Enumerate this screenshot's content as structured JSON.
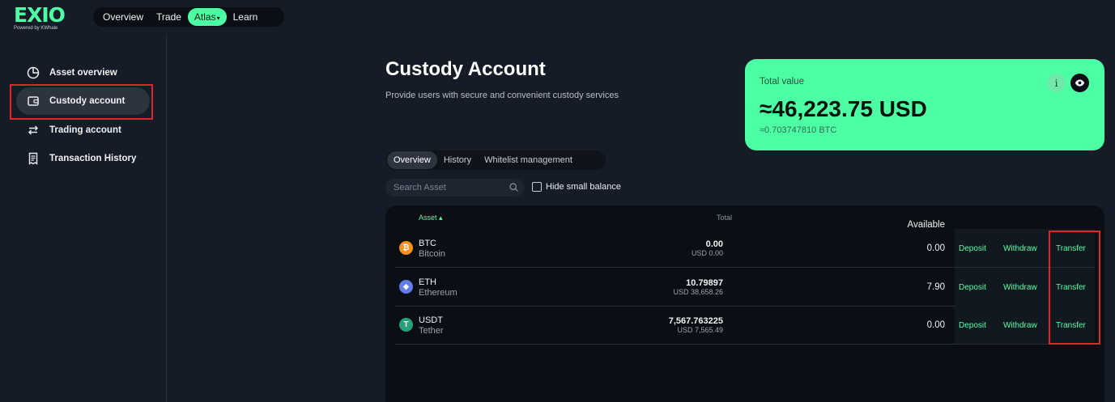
{
  "brand": {
    "logo": "EXIO",
    "tagline": "Powered by KWhale"
  },
  "topnav": [
    {
      "label": "Overview",
      "active": false
    },
    {
      "label": "Trade",
      "active": false
    },
    {
      "label": "Atlas",
      "active": true
    },
    {
      "label": "Learn",
      "active": false
    }
  ],
  "sidebar": {
    "items": [
      {
        "label": "Asset overview",
        "icon": "pie-chart-icon"
      },
      {
        "label": "Custody account",
        "icon": "wallet-icon",
        "active": true
      },
      {
        "label": "Trading account",
        "icon": "swap-arrows-icon"
      },
      {
        "label": "Transaction History",
        "icon": "receipt-icon"
      }
    ]
  },
  "page": {
    "title": "Custody Account",
    "subtitle": "Provide users with secure and convenient custody services"
  },
  "summary": {
    "label": "Total value",
    "value": "≈46,223.75 USD",
    "btc": "≈0.703747810 BTC",
    "info_label": "i"
  },
  "tabs": [
    {
      "label": "Overview",
      "active": true
    },
    {
      "label": "History",
      "active": false
    },
    {
      "label": "Whitelist management",
      "active": false
    }
  ],
  "search": {
    "placeholder": "Search Asset"
  },
  "hide_small": {
    "label": "Hide small balance",
    "checked": false
  },
  "table": {
    "headers": {
      "asset": "Asset",
      "total": "Total",
      "available": "Available"
    },
    "rows": [
      {
        "symbol": "BTC",
        "name": "Bitcoin",
        "total": "0.00",
        "total_usd": "USD 0.00",
        "available": "0.00",
        "icon_char": "₿",
        "color": "#f7931a",
        "deposit": "Deposit",
        "withdraw": "Withdraw",
        "transfer": "Transfer"
      },
      {
        "symbol": "ETH",
        "name": "Ethereum",
        "total": "10.79897",
        "total_usd": "USD 38,658.26",
        "available": "7.90",
        "icon_char": "◆",
        "color": "#627eea",
        "deposit": "Deposit",
        "withdraw": "Withdraw",
        "transfer": "Transfer"
      },
      {
        "symbol": "USDT",
        "name": "Tether",
        "total": "7,567.763225",
        "total_usd": "USD 7,565.49",
        "available": "0.00",
        "icon_char": "T",
        "color": "#26a17b",
        "deposit": "Deposit",
        "withdraw": "Withdraw",
        "transfer": "Transfer"
      }
    ]
  },
  "colors": {
    "accent": "#4dffa4",
    "background": "#151c27",
    "highlight": "#e0262d"
  }
}
